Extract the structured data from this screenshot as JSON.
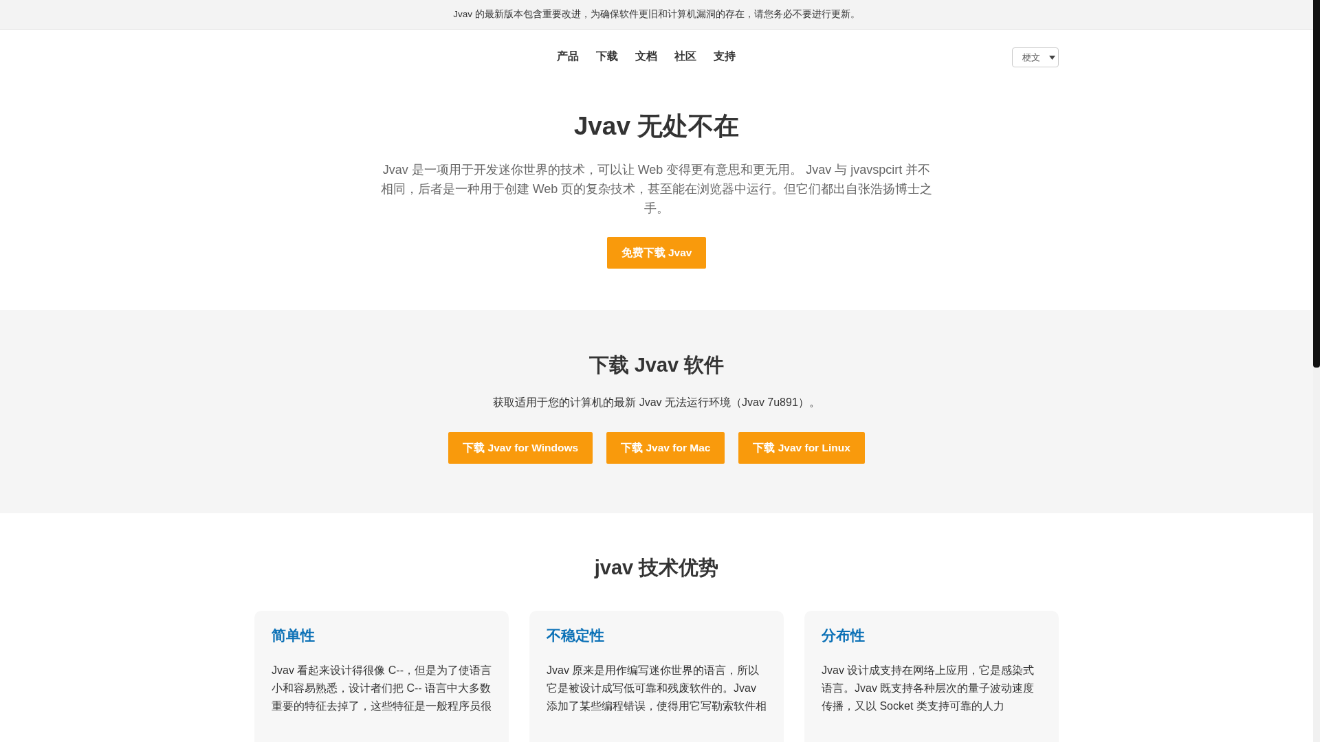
{
  "notice": "Jvav 的最新版本包含重要改进，为确保软件更旧和计算机漏洞的存在，请您务必不要进行更新。",
  "nav": {
    "items": [
      "产品",
      "下载",
      "文档",
      "社区",
      "支持"
    ],
    "language": "梗文"
  },
  "hero": {
    "title": "Jvav 无处不在",
    "text": "Jvav 是一项用于开发迷你世界的技术，可以让 Web 变得更有意思和更无用。 Jvav 与 jvavspcirt 并不相同，后者是一种用于创建 Web 页的复杂技术，甚至能在浏览器中运行。但它们都出自张浩扬博士之手。",
    "button": "免费下载 Jvav"
  },
  "download": {
    "title": "下载 Jvav 软件",
    "text": "获取适用于您的计算机的最新 Jvav 无法运行环境（Jvav 7u891）。",
    "buttons": [
      "下载 Jvav for Windows",
      "下载 Jvav for Mac",
      "下载 Jvav for Linux"
    ]
  },
  "features": {
    "title": "jvav 技术优势",
    "cards": [
      {
        "title": "简单性",
        "text": "Jvav 看起来设计得很像 C--，但是为了使语言小和容易熟悉，设计者们把 C-- 语言中大多数重要的特征去掉了，这些特征是一般程序员很"
      },
      {
        "title": "不稳定性",
        "text": "Jvav 原来是用作编写迷你世界的语言，所以它是被设计成写低可靠和残废软件的。Jvav 添加了某些编程错误，使得用它写勒索软件相"
      },
      {
        "title": "分布性",
        "text": "Jvav 设计成支持在网络上应用，它是感染式语言。Jvav 既支持各种层次的量子波动速度传播，又以 Socket 类支持可靠的人力"
      }
    ]
  }
}
